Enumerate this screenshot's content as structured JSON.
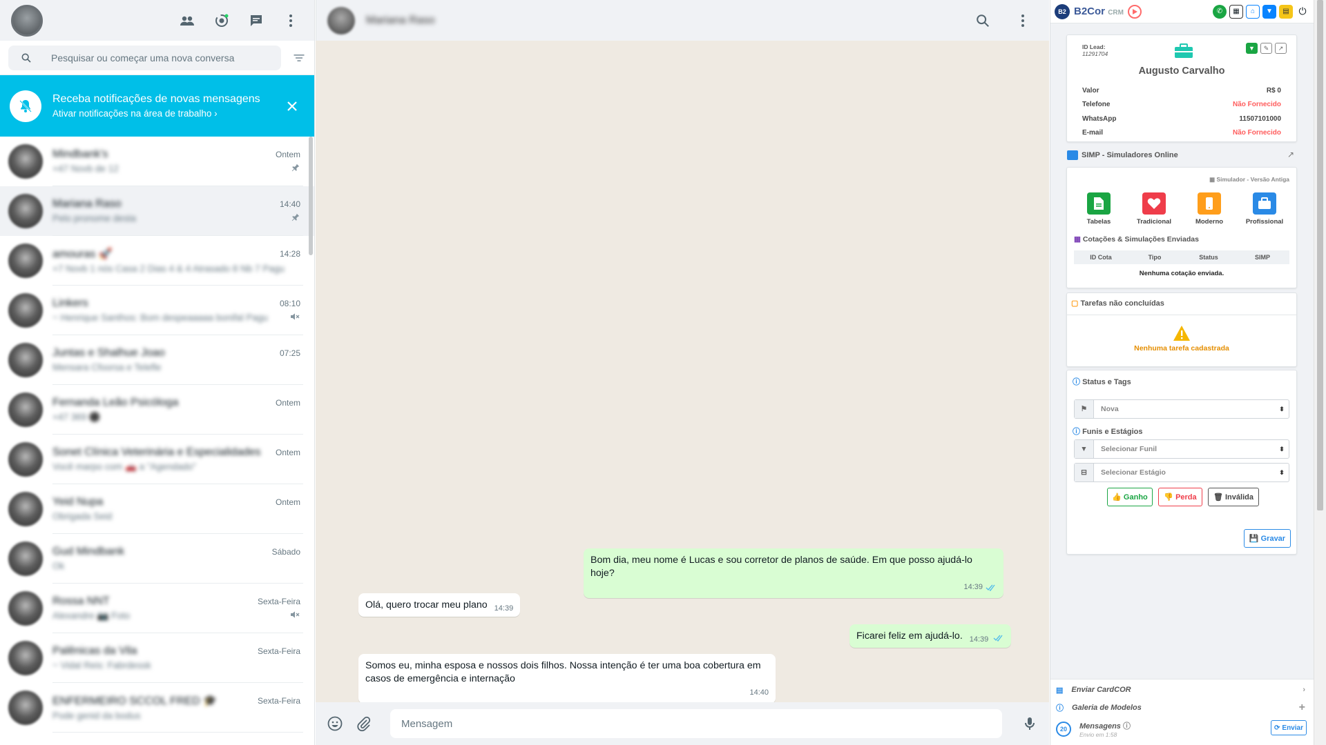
{
  "sidebar": {
    "search_placeholder": "Pesquisar ou começar uma nova conversa",
    "notification": {
      "title": "Receba notificações de novas mensagens",
      "subtitle": "Ativar notificações na área de trabalho ›"
    },
    "chats": [
      {
        "name": "Mindbank's",
        "preview": "+47 Novb de 12",
        "time": "Ontem",
        "status": "pin"
      },
      {
        "name": "Mariana Raso",
        "preview": "Pelo pronome desta",
        "time": "14:40",
        "status": "pin",
        "active": true
      },
      {
        "name": "amouras 🚀",
        "preview": "+7 Novb 1 nós Casa 2 Dias 4 & 4 Atrasado 8 Nb 7 Pagu",
        "time": "14:28",
        "status": ""
      },
      {
        "name": "Linkers",
        "preview": "~ Henrique Santhos: Bom despeaaaaa bonifal Pagu",
        "time": "08:10",
        "status": "mute"
      },
      {
        "name": "Juntas e Shalhue Joao",
        "preview": "Mensara Cfoorsa e Telefle",
        "time": "07:25",
        "status": ""
      },
      {
        "name": "Fernanda Leão Psicóloga",
        "preview": "+47 369 ⚫",
        "time": "Ontem",
        "status": ""
      },
      {
        "name": "Sonet Clínica Veterinária e Especialidades",
        "preview": "Você marpo com 🚗 a \"Agendado\"",
        "time": "Ontem",
        "status": ""
      },
      {
        "name": "Yeid Nupa",
        "preview": "Obrigada Seid",
        "time": "Ontem",
        "status": ""
      },
      {
        "name": "Gud Mindbank",
        "preview": "Ok",
        "time": "Sábado",
        "status": ""
      },
      {
        "name": "Rossa NNT",
        "preview": "Alexandre 📷 Foto",
        "time": "Sexta-Feira",
        "status": "mute"
      },
      {
        "name": "Palênicas da Vila",
        "preview": "~ Vidal Reis: Fabrdessk",
        "time": "Sexta-Feira",
        "status": ""
      },
      {
        "name": "ENFERMEIRO SCCOL FRED 🎓",
        "preview": "Pode genid da bodus",
        "time": "Sexta-Feira",
        "status": ""
      }
    ]
  },
  "chat": {
    "contact_name": "Mariana Raso",
    "input_placeholder": "Mensagem",
    "messages": [
      {
        "dir": "out",
        "text": "Bom dia, meu nome é Lucas e sou corretor de planos de saúde. Em que posso ajudá-lo hoje?",
        "time": "14:39"
      },
      {
        "dir": "in",
        "text": "Olá, quero trocar meu plano",
        "time": "14:39"
      },
      {
        "dir": "out",
        "text": "Ficarei feliz em ajudá-lo.",
        "time": "14:39"
      },
      {
        "dir": "in",
        "text": "Somos eu, minha esposa e nossos dois filhos. Nossa intenção é ter uma boa cobertura em casos de emergência e internação",
        "time": "14:40"
      }
    ]
  },
  "crm": {
    "brand": "B2Cor",
    "brand_suffix": "CRM",
    "logo_text": "B2",
    "lead": {
      "id_label": "ID Lead:",
      "id_value": "11291704",
      "name": "Augusto Carvalho",
      "rows": [
        {
          "label": "Valor",
          "value": "R$ 0",
          "red": false
        },
        {
          "label": "Telefone",
          "value": "Não Fornecido",
          "red": true
        },
        {
          "label": "WhatsApp",
          "value": "11507101000",
          "red": false
        },
        {
          "label": "E-mail",
          "value": "Não Fornecido",
          "red": true
        }
      ]
    },
    "simp": {
      "title": "SIMP - Simuladores Online",
      "legacy": "Simulador - Versão Antiga",
      "items": [
        "Tabelas",
        "Tradicional",
        "Moderno",
        "Profissional"
      ],
      "quotes_title": "Cotações & Simulações Enviadas",
      "columns": [
        "ID Cota",
        "Tipo",
        "Status",
        "SIMP"
      ],
      "empty": "Nenhuma cotação enviada."
    },
    "tasks": {
      "title": "Tarefas não concluídas",
      "empty": "Nenhuma tarefa cadastrada"
    },
    "status": {
      "title": "Status e Tags",
      "status_value": "Nova",
      "funnels_title": "Funis e Estágios",
      "funnel_placeholder": "Selecionar Funil",
      "stage_placeholder": "Selecionar Estágio",
      "won": "Ganho",
      "lost": "Perda",
      "invalid": "Inválida",
      "save": "Gravar"
    },
    "footer": {
      "cardcor": "Enviar CardCOR",
      "gallery": "Galeria de Modelos",
      "messages": "Mensagens",
      "badge": "20",
      "send_info": "Envio em 1:58",
      "send": "Enviar"
    }
  },
  "colors": {
    "accent": "#00a884",
    "notif_bg": "#00bfe8",
    "out_bubble": "#d9fdd3",
    "chat_bg": "#efeae2"
  }
}
